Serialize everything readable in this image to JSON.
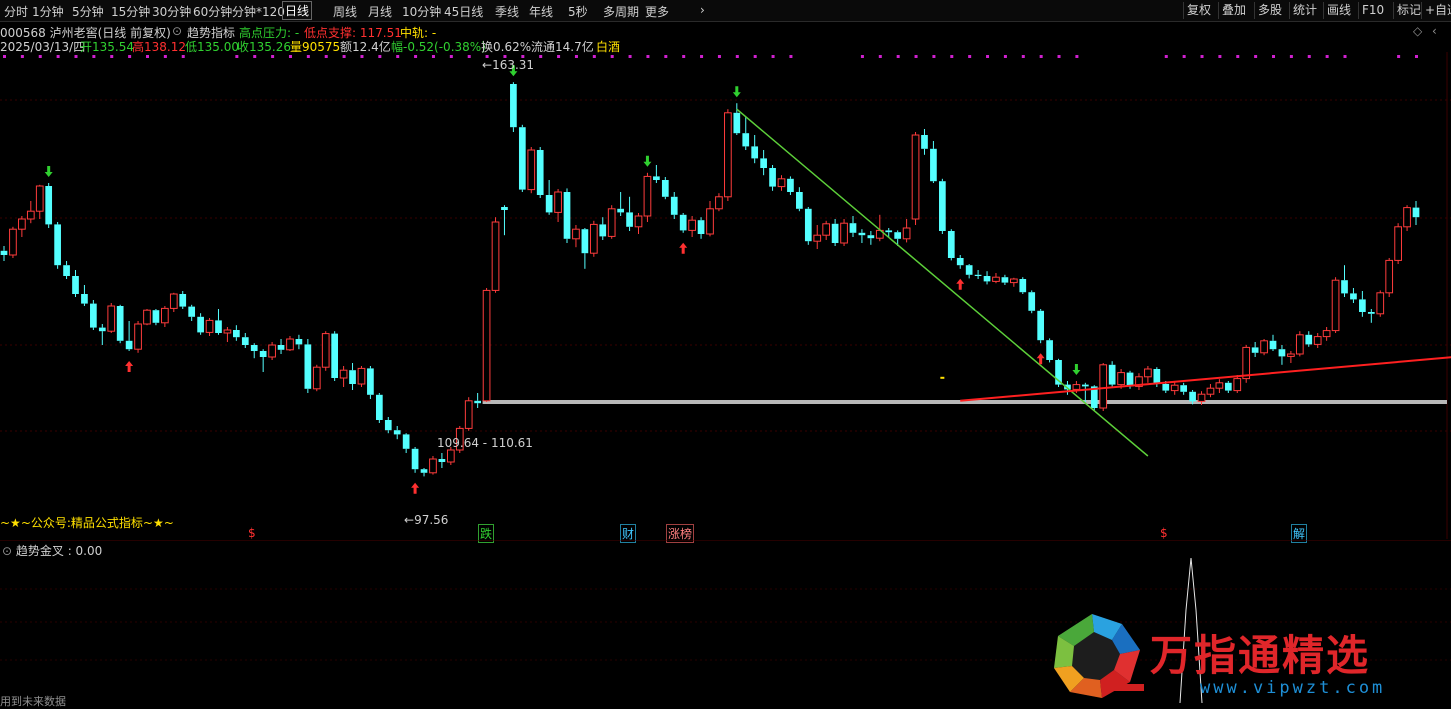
{
  "toolbar": {
    "timeframes": [
      "分时",
      "1分钟",
      "5分钟",
      "15分钟",
      "30分钟",
      "60分钟",
      "分钟*120",
      "日线",
      "周线",
      "月线",
      "10分钟",
      "45日线",
      "季线",
      "年线",
      "5秒",
      "多周期",
      "更多"
    ],
    "active": "日线",
    "right_buttons": [
      "复权",
      "叠加",
      "多股",
      "统计",
      "画线",
      "F10",
      "标记",
      "+自选"
    ]
  },
  "stock_header": {
    "code_name": "000568 泸州老窖(日线 前复权)",
    "indicator_name": "趋势指标",
    "high_pressure": "高点压力: -",
    "low_support": "低点支撑: 117.51",
    "middle_track": "中轨: -"
  },
  "ohlc_line": {
    "date": "2025/03/13/四",
    "open": "开135.54",
    "high": "高138.12",
    "low": "低135.00",
    "close": "收135.26",
    "volume": "量90575",
    "amount": "额12.4亿",
    "change": "幅-0.52(-0.38%)",
    "turnover": "换0.62%",
    "float_cap": "流通14.7亿",
    "sector": "白酒"
  },
  "price_labels": {
    "peak": "163.31",
    "trough": "97.56",
    "support_band": "109.64 - 110.61"
  },
  "event_markers": [
    {
      "text": "$",
      "color": "#ff3030"
    },
    {
      "text": "跌",
      "color": "#30d030"
    },
    {
      "text": "财",
      "color": "#40c8ff"
    },
    {
      "text": "涨榜",
      "color": "#ff8080"
    },
    {
      "text": "$",
      "color": "#ff3030"
    },
    {
      "text": "解",
      "color": "#40c8ff"
    }
  ],
  "footer_note": "~★~公众号:精品公式指标~★~",
  "bottom_left_truncated": "用到未来数据",
  "sub_indicator": {
    "label": "趋势金叉 : 0.00"
  },
  "watermark": {
    "brand": "万指通精选",
    "url": "www.vipwzt.com"
  },
  "colors": {
    "up": "#ff3c3c",
    "down": "#54ffff",
    "trend_down": "#5dd03a",
    "trend_up": "#ff2020",
    "support": "#b0b0b0"
  },
  "chart_data": {
    "type": "candlestick",
    "ylim": [
      90,
      168
    ],
    "candles": [
      [
        135.2,
        136.0,
        133.5,
        134.5
      ],
      [
        134.5,
        139.2,
        134.0,
        138.8
      ],
      [
        138.8,
        141.0,
        137.5,
        140.5
      ],
      [
        140.5,
        143.5,
        139.8,
        141.8
      ],
      [
        141.8,
        146.2,
        140.5,
        146.0
      ],
      [
        146.0,
        146.5,
        139.0,
        139.6
      ],
      [
        139.6,
        140.0,
        132.2,
        132.8
      ],
      [
        132.8,
        133.5,
        130.5,
        131.0
      ],
      [
        131.0,
        132.0,
        127.5,
        128.0
      ],
      [
        128.0,
        129.5,
        126.0,
        126.4
      ],
      [
        126.4,
        127.0,
        122.0,
        122.4
      ],
      [
        122.4,
        123.0,
        119.5,
        121.8
      ],
      [
        121.8,
        126.5,
        121.5,
        126.0
      ],
      [
        126.0,
        126.2,
        119.8,
        120.2
      ],
      [
        120.2,
        123.5,
        118.5,
        118.8
      ],
      [
        118.8,
        123.5,
        118.2,
        123.0
      ],
      [
        123.0,
        125.5,
        122.8,
        125.3
      ],
      [
        125.3,
        125.5,
        122.8,
        123.2
      ],
      [
        123.2,
        126.0,
        122.5,
        125.6
      ],
      [
        125.6,
        128.2,
        125.0,
        128.0
      ],
      [
        128.0,
        128.5,
        125.5,
        125.9
      ],
      [
        125.9,
        126.2,
        123.5,
        124.2
      ],
      [
        124.2,
        124.8,
        121.2,
        121.6
      ],
      [
        121.6,
        124.0,
        121.0,
        123.6
      ],
      [
        123.6,
        125.5,
        121.2,
        121.5
      ],
      [
        121.5,
        122.5,
        120.0,
        122.0
      ],
      [
        122.0,
        122.8,
        120.2,
        120.8
      ],
      [
        120.8,
        121.5,
        119.0,
        119.5
      ],
      [
        119.5,
        119.8,
        117.3,
        118.5
      ],
      [
        118.5,
        118.8,
        115.0,
        117.5
      ],
      [
        117.5,
        120.0,
        117.0,
        119.5
      ],
      [
        119.5,
        120.5,
        118.0,
        118.7
      ],
      [
        118.7,
        121.0,
        118.5,
        120.5
      ],
      [
        120.5,
        121.2,
        118.8,
        119.6
      ],
      [
        119.6,
        120.5,
        111.5,
        112.2
      ],
      [
        112.2,
        116.2,
        111.8,
        115.8
      ],
      [
        115.8,
        121.8,
        115.2,
        121.4
      ],
      [
        121.4,
        121.8,
        113.5,
        114.0
      ],
      [
        114.0,
        116.0,
        112.5,
        115.3
      ],
      [
        115.3,
        116.5,
        112.0,
        113.0
      ],
      [
        113.0,
        116.0,
        112.5,
        115.6
      ],
      [
        115.6,
        116.0,
        110.5,
        111.2
      ],
      [
        111.2,
        111.5,
        106.5,
        107.0
      ],
      [
        107.0,
        107.5,
        104.8,
        105.3
      ],
      [
        105.3,
        106.0,
        103.8,
        104.6
      ],
      [
        104.6,
        104.8,
        101.5,
        102.2
      ],
      [
        102.2,
        102.5,
        98.2,
        98.8
      ],
      [
        98.8,
        99.0,
        97.6,
        98.2
      ],
      [
        98.2,
        101.0,
        97.9,
        100.5
      ],
      [
        100.5,
        101.5,
        99.0,
        100.0
      ],
      [
        100.0,
        102.5,
        99.5,
        102.0
      ],
      [
        102.0,
        106.0,
        101.5,
        105.6
      ],
      [
        105.6,
        110.8,
        105.2,
        110.2
      ],
      [
        110.2,
        111.5,
        109.0,
        109.8
      ],
      [
        110.2,
        129.0,
        110.0,
        128.6
      ],
      [
        128.6,
        140.8,
        128.2,
        140.0
      ],
      [
        142.5,
        142.8,
        137.8,
        142.0
      ],
      [
        163.0,
        163.3,
        155.0,
        155.8
      ],
      [
        155.8,
        156.2,
        145.0,
        145.4
      ],
      [
        145.4,
        152.5,
        144.8,
        152.0
      ],
      [
        152.0,
        152.5,
        144.0,
        144.5
      ],
      [
        144.5,
        147.0,
        141.2,
        141.6
      ],
      [
        141.6,
        145.5,
        140.0,
        145.0
      ],
      [
        145.0,
        145.6,
        136.5,
        137.2
      ],
      [
        137.2,
        139.5,
        135.8,
        138.8
      ],
      [
        138.8,
        139.0,
        132.2,
        134.8
      ],
      [
        134.8,
        140.2,
        134.2,
        139.6
      ],
      [
        139.6,
        140.8,
        137.0,
        137.6
      ],
      [
        137.6,
        142.8,
        137.2,
        142.2
      ],
      [
        142.2,
        145.0,
        141.0,
        141.6
      ],
      [
        141.6,
        144.2,
        138.5,
        139.2
      ],
      [
        139.2,
        141.5,
        138.0,
        141.0
      ],
      [
        141.0,
        148.2,
        140.0,
        147.6
      ],
      [
        147.6,
        149.5,
        146.5,
        147.0
      ],
      [
        147.0,
        147.5,
        143.8,
        144.2
      ],
      [
        144.2,
        145.0,
        140.5,
        141.2
      ],
      [
        141.2,
        141.5,
        138.2,
        138.6
      ],
      [
        138.6,
        141.0,
        137.5,
        140.3
      ],
      [
        140.3,
        140.8,
        137.2,
        138.0
      ],
      [
        138.0,
        143.5,
        137.6,
        142.2
      ],
      [
        142.2,
        144.8,
        141.8,
        144.2
      ],
      [
        144.2,
        158.8,
        143.5,
        158.2
      ],
      [
        158.2,
        159.8,
        154.5,
        154.8
      ],
      [
        154.8,
        157.5,
        152.0,
        152.6
      ],
      [
        152.6,
        154.5,
        149.8,
        150.6
      ],
      [
        150.6,
        152.0,
        147.8,
        149.0
      ],
      [
        149.0,
        149.5,
        145.2,
        145.9
      ],
      [
        145.9,
        147.8,
        145.2,
        147.2
      ],
      [
        147.2,
        147.6,
        144.5,
        145.0
      ],
      [
        145.0,
        145.8,
        141.8,
        142.2
      ],
      [
        142.2,
        142.5,
        136.2,
        136.8
      ],
      [
        136.8,
        139.5,
        135.5,
        137.8
      ],
      [
        137.8,
        140.2,
        137.0,
        139.7
      ],
      [
        139.7,
        140.5,
        136.0,
        136.5
      ],
      [
        136.5,
        140.5,
        136.0,
        139.8
      ],
      [
        139.8,
        141.0,
        137.5,
        138.2
      ],
      [
        138.2,
        138.8,
        136.5,
        137.8
      ],
      [
        137.8,
        138.5,
        136.2,
        137.3
      ],
      [
        137.3,
        141.2,
        136.8,
        138.6
      ],
      [
        138.6,
        139.0,
        137.5,
        138.3
      ],
      [
        138.3,
        138.6,
        136.0,
        137.2
      ],
      [
        137.2,
        140.5,
        136.6,
        139.0
      ],
      [
        140.5,
        155.0,
        139.5,
        154.5
      ],
      [
        154.5,
        155.5,
        151.2,
        152.2
      ],
      [
        152.2,
        153.5,
        146.5,
        146.8
      ],
      [
        146.8,
        147.2,
        138.0,
        138.5
      ],
      [
        138.5,
        138.8,
        133.6,
        134.0
      ],
      [
        134.0,
        134.5,
        132.2,
        132.8
      ],
      [
        132.8,
        133.0,
        130.6,
        131.2
      ],
      [
        131.2,
        132.0,
        130.5,
        131.0
      ],
      [
        131.0,
        131.8,
        129.6,
        130.1
      ],
      [
        130.1,
        131.5,
        129.8,
        130.8
      ],
      [
        130.8,
        131.2,
        129.5,
        129.9
      ],
      [
        129.9,
        130.7,
        129.2,
        130.5
      ],
      [
        130.5,
        130.8,
        128.0,
        128.3
      ],
      [
        128.3,
        128.6,
        124.8,
        125.2
      ],
      [
        125.2,
        125.5,
        119.8,
        120.3
      ],
      [
        120.3,
        120.6,
        116.6,
        117.0
      ],
      [
        117.0,
        117.2,
        112.5,
        112.9
      ],
      [
        112.9,
        113.5,
        111.2,
        112.1
      ],
      [
        112.1,
        113.5,
        111.5,
        112.9
      ],
      [
        112.9,
        113.2,
        110.0,
        112.6
      ],
      [
        112.6,
        112.8,
        108.6,
        109.0
      ],
      [
        109.0,
        116.5,
        108.5,
        116.2
      ],
      [
        116.2,
        116.8,
        112.5,
        112.9
      ],
      [
        112.9,
        115.5,
        112.2,
        114.9
      ],
      [
        114.9,
        115.2,
        112.2,
        112.6
      ],
      [
        112.6,
        114.8,
        112.0,
        114.2
      ],
      [
        114.2,
        116.0,
        113.2,
        115.5
      ],
      [
        115.5,
        115.8,
        112.5,
        113.0
      ],
      [
        113.0,
        113.5,
        111.5,
        111.9
      ],
      [
        111.9,
        113.5,
        111.2,
        112.8
      ],
      [
        112.8,
        113.2,
        111.2,
        111.7
      ],
      [
        111.7,
        112.0,
        109.6,
        110.1
      ],
      [
        110.1,
        111.8,
        109.5,
        111.3
      ],
      [
        111.3,
        113.0,
        110.8,
        112.3
      ],
      [
        112.3,
        113.8,
        111.5,
        113.2
      ],
      [
        113.2,
        113.5,
        111.5,
        111.9
      ],
      [
        111.9,
        114.5,
        111.5,
        113.9
      ],
      [
        113.9,
        119.5,
        113.2,
        119.1
      ],
      [
        119.1,
        120.0,
        117.5,
        118.2
      ],
      [
        118.2,
        120.5,
        117.8,
        120.2
      ],
      [
        120.2,
        121.2,
        118.5,
        118.8
      ],
      [
        118.8,
        119.5,
        116.2,
        117.6
      ],
      [
        117.6,
        118.5,
        116.5,
        118.0
      ],
      [
        118.0,
        121.8,
        117.6,
        121.2
      ],
      [
        121.2,
        121.8,
        119.2,
        119.6
      ],
      [
        119.6,
        121.5,
        119.0,
        120.9
      ],
      [
        120.9,
        122.5,
        120.2,
        121.9
      ],
      [
        121.9,
        130.8,
        121.5,
        130.3
      ],
      [
        130.3,
        132.8,
        127.5,
        128.1
      ],
      [
        128.1,
        129.0,
        126.5,
        127.1
      ],
      [
        127.1,
        128.5,
        124.2,
        125.0
      ],
      [
        125.0,
        125.5,
        123.2,
        124.7
      ],
      [
        124.7,
        128.6,
        124.2,
        128.2
      ],
      [
        128.2,
        134.0,
        127.5,
        133.6
      ],
      [
        133.6,
        139.8,
        133.0,
        139.2
      ],
      [
        139.2,
        142.8,
        138.5,
        142.4
      ],
      [
        142.4,
        143.5,
        139.5,
        140.8
      ]
    ],
    "trend_lines": [
      {
        "name": "down-trend",
        "color": "#5dd03a",
        "points": [
          [
            "c82",
            158.8
          ],
          [
            "c128",
            101.0
          ]
        ]
      },
      {
        "name": "up-trend",
        "color": "#ff2020",
        "points": [
          [
            "c107",
            110.2
          ],
          [
            "c166",
            118.0
          ]
        ]
      }
    ],
    "support_line": {
      "y": 110.0,
      "from": "c54"
    }
  }
}
